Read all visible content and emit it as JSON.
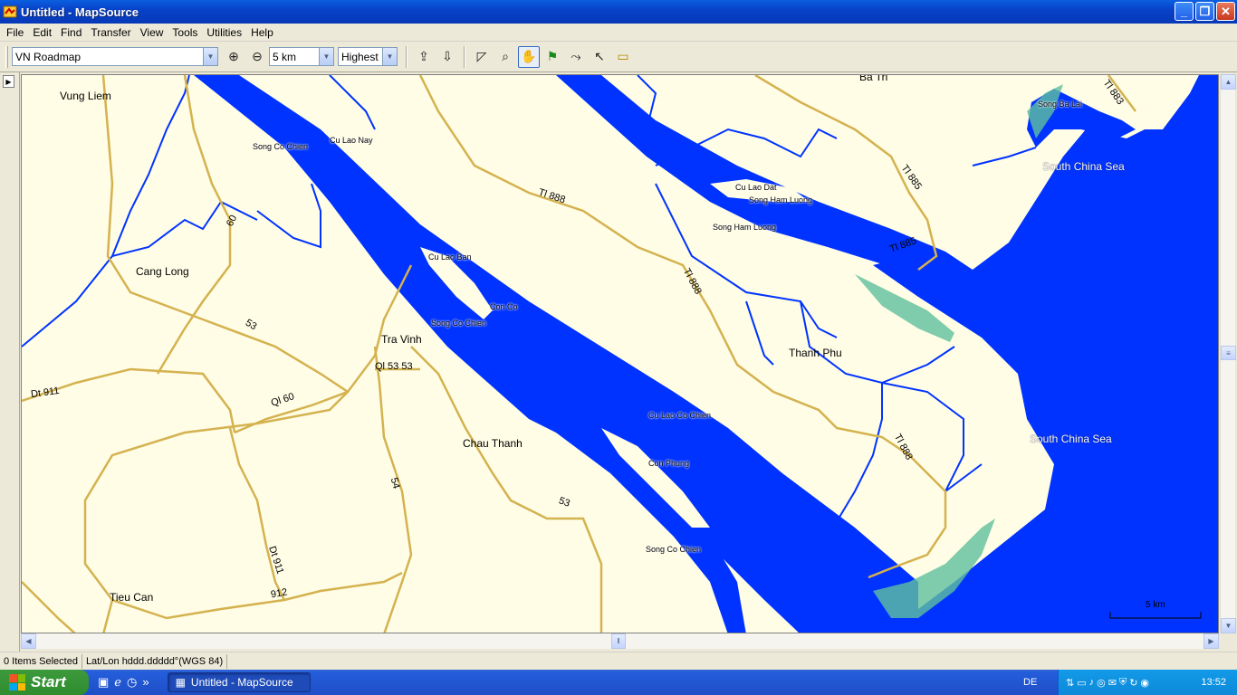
{
  "window": {
    "title": "Untitled - MapSource"
  },
  "menu": [
    "File",
    "Edit",
    "Find",
    "Transfer",
    "View",
    "Tools",
    "Utilities",
    "Help"
  ],
  "toolbar": {
    "map_product": "VN Roadmap",
    "zoom_level": "5 km",
    "detail_level": "Highest",
    "icons": [
      "zoom-in-icon",
      "zoom-out-icon",
      "receive-from-device-icon",
      "send-to-device-icon",
      "map-tool-icon",
      "zoom-tool-icon",
      "hand-tool-icon",
      "waypoint-tool-icon",
      "route-tool-icon",
      "selection-tool-icon",
      "distance-tool-icon"
    ]
  },
  "map": {
    "places": {
      "vung_liem": "Vung Liem",
      "cang_long": "Cang Long",
      "tra_vinh": "Tra Vinh",
      "chau_thanh": "Chau Thanh",
      "tieu_can": "Tieu Can",
      "thanh_phu": "Thanh Phu",
      "ba_tri": "Ba Tri"
    },
    "water": {
      "song_co_chien_1": "Song Co Chien",
      "song_co_chien_2": "Song Co Chien",
      "song_co_chien_3": "Song Co Chien",
      "cu_lao_nay": "Cu Lao Nay",
      "cu_lao_ban": "Cu Lao Ban",
      "con_co": "Con Co",
      "cu_lao_co_chien": "Cu Lao Co Chien",
      "con_phung": "Con Phung",
      "cu_lao_dat": "Cu Lao Dat",
      "song_ham_luong_1": "Song Ham Luong",
      "song_ham_luong_2": "Song Ham Luong",
      "song_ba_lai": "Song Ba Lai",
      "sea_1": "South China Sea",
      "sea_2": "South China Sea"
    },
    "roads": {
      "tl888_a": "Tl 888",
      "tl888_b": "Tl 888",
      "tl888_c": "Tl 888",
      "tl885_a": "Tl 885",
      "tl885_b": "Tl 885",
      "tl883": "Tl 883",
      "r60": "60",
      "r53_a": "53",
      "r53_b": "53",
      "ql53": "Ql 53 53",
      "ql60": "Ql 60",
      "dt911_a": "Dt 911",
      "dt911_b": "Dt 911",
      "r54": "54",
      "r912": "912"
    },
    "scale_label": "5 km"
  },
  "status": {
    "selection": "0 Items Selected",
    "position_format": "Lat/Lon hddd.ddddd°(WGS 84)"
  },
  "taskbar": {
    "start_label": "Start",
    "task_title": "Untitled - MapSource",
    "language": "DE",
    "clock": "13:52"
  },
  "colors": {
    "water": "#0033ff",
    "land": "#fffde6",
    "road": "#e8c872",
    "mangrove": "#5fbf9f"
  }
}
